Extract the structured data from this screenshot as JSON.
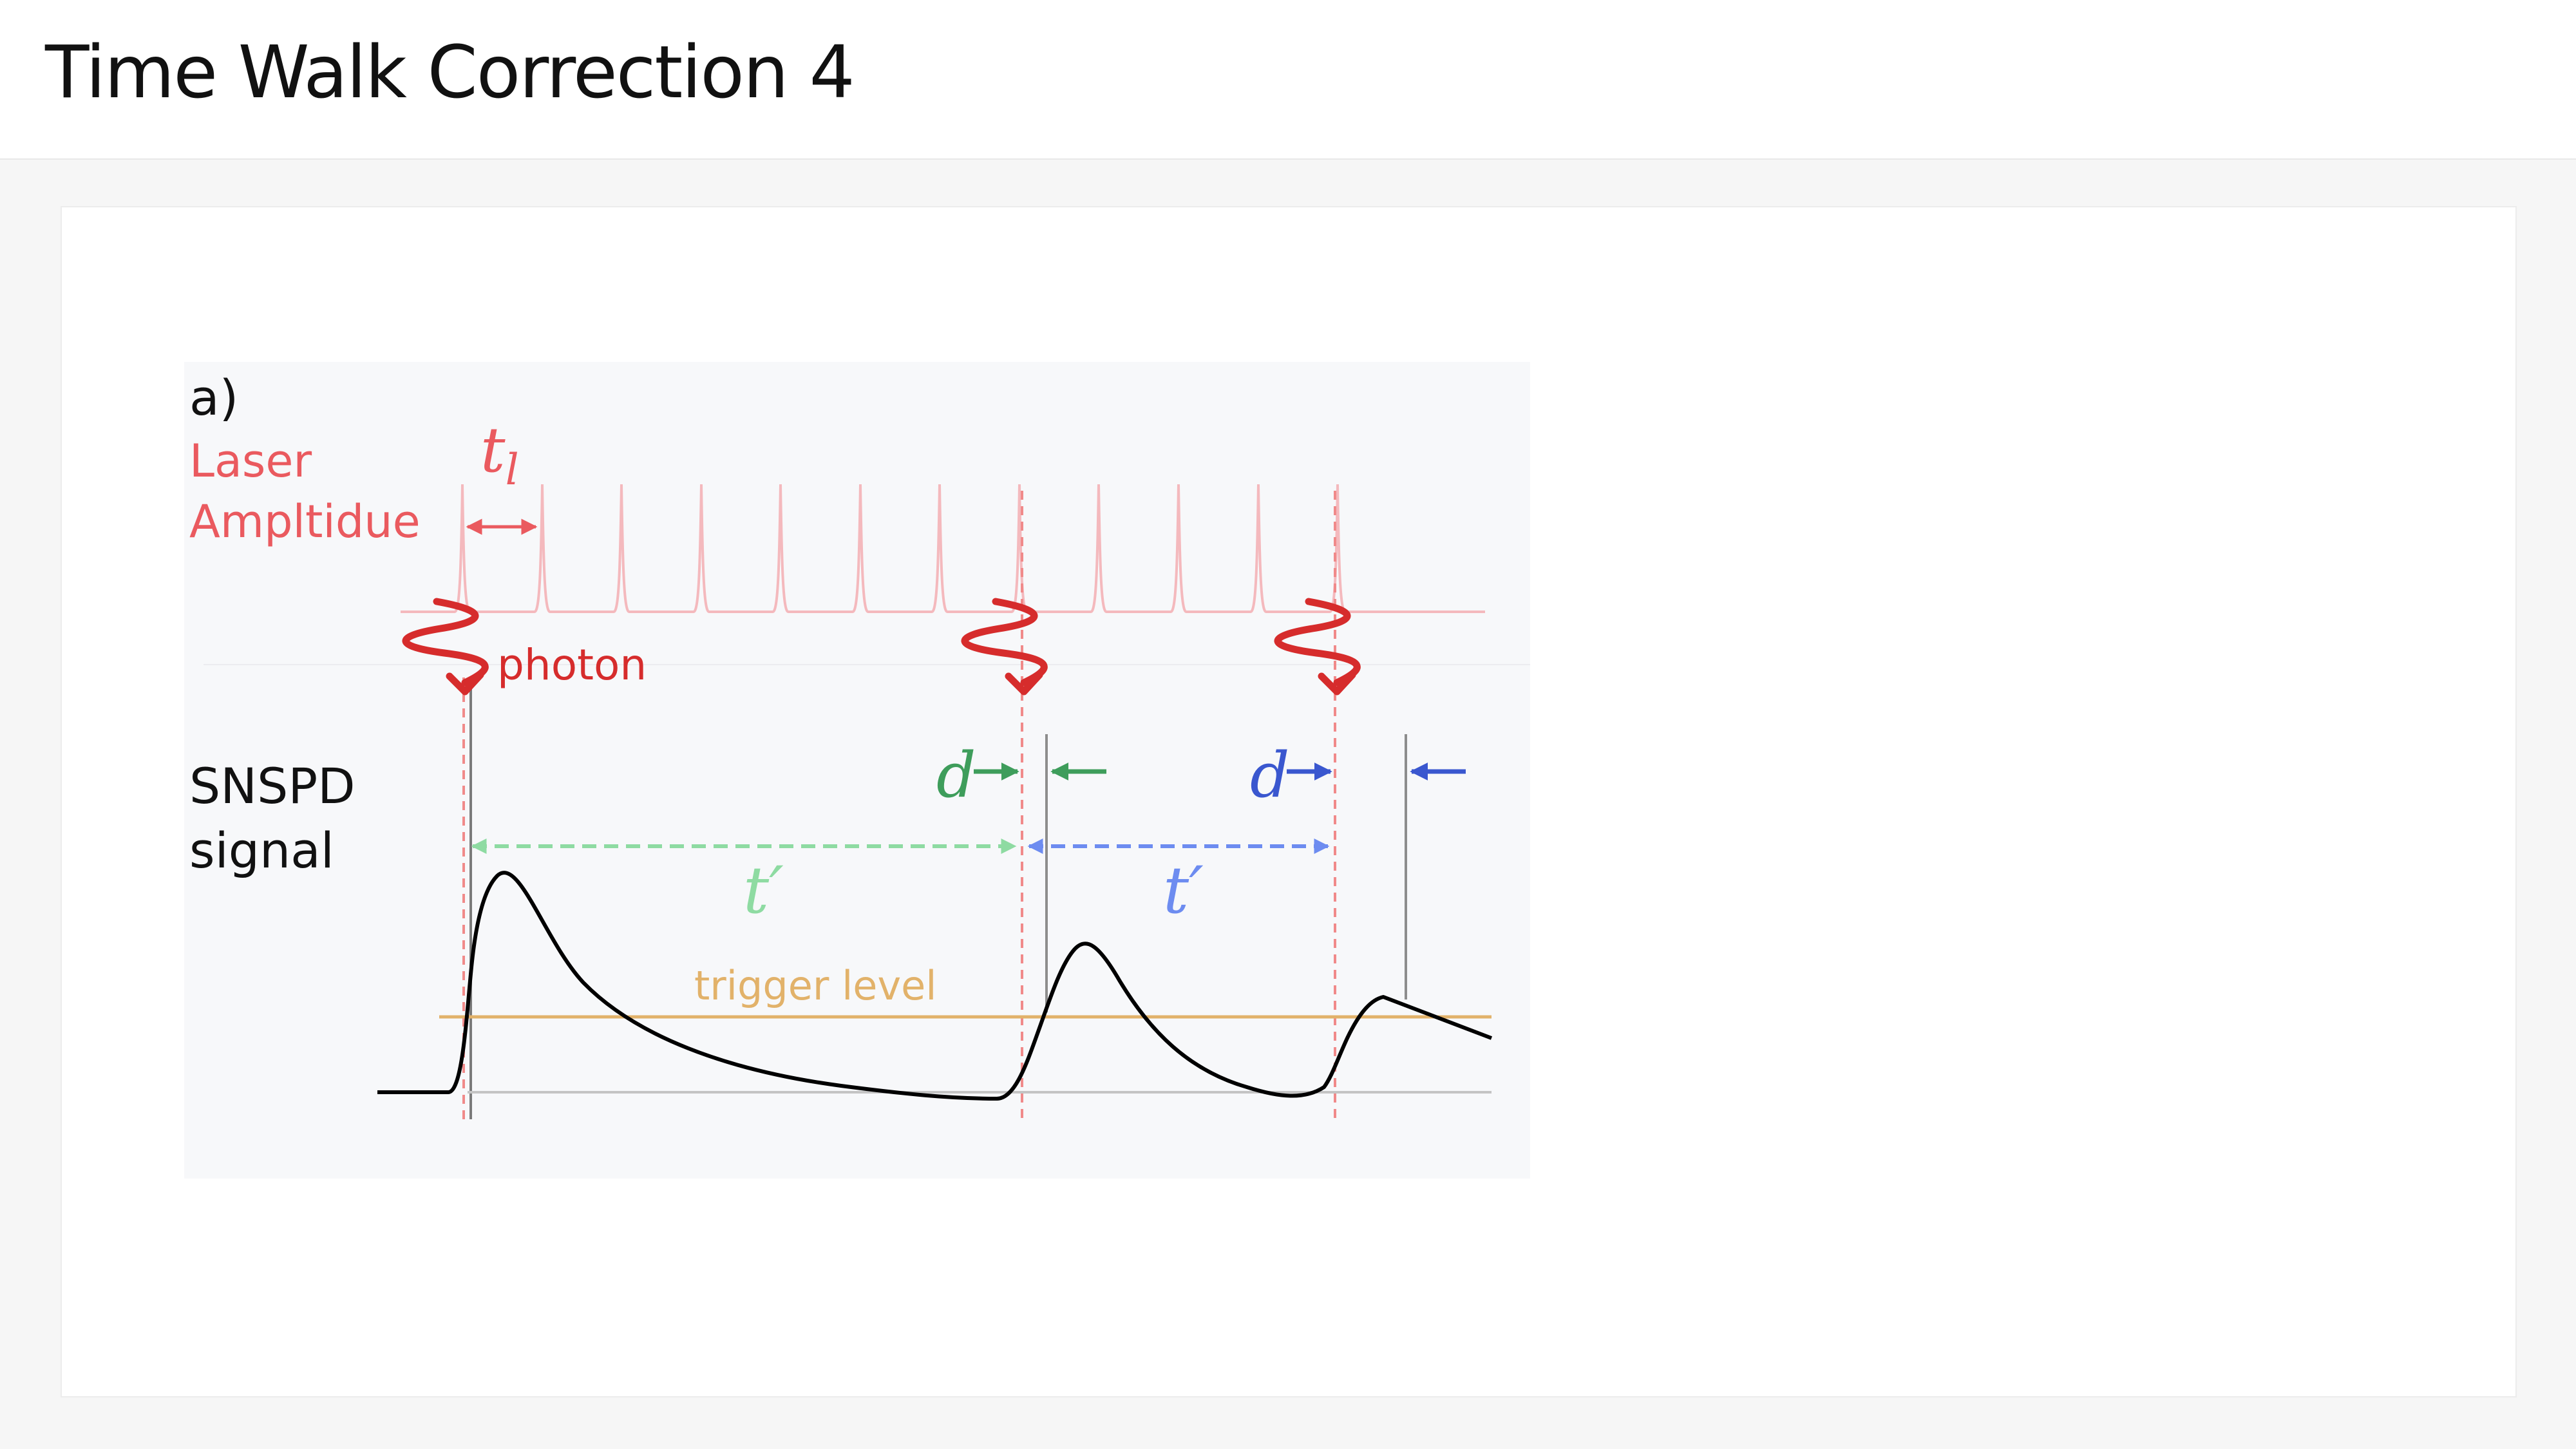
{
  "page": {
    "title": "Time Walk Correction 4"
  },
  "figure": {
    "panel_label": "a)",
    "laser_label_line1": "Laser",
    "laser_label_line2": "Ampltidue",
    "laser_period_symbol": "t",
    "laser_period_subscript": "l",
    "photon_label": "photon",
    "snspd_label_line1": "SNSPD",
    "snspd_label_line2": "signal",
    "delay_symbol_1": "d",
    "delay_symbol_2": "d",
    "interval_symbol_1": "t′",
    "interval_symbol_2": "t′",
    "trigger_label": "trigger level",
    "colors": {
      "laser": "#f4b9bd",
      "laser_text": "#ea5a5f",
      "photon": "#d62c2c",
      "marker_line": "#f08a8a",
      "green": "#3e9d5b",
      "light_green": "#8edba2",
      "blue": "#3a57cf",
      "light_blue": "#6d8cf0",
      "trigger": "#e2b26a",
      "signal": "#000000",
      "baseline": "#c4c4c4",
      "detection_line": "#8d8d8d",
      "panel_bg": "#f7f8fa"
    }
  }
}
